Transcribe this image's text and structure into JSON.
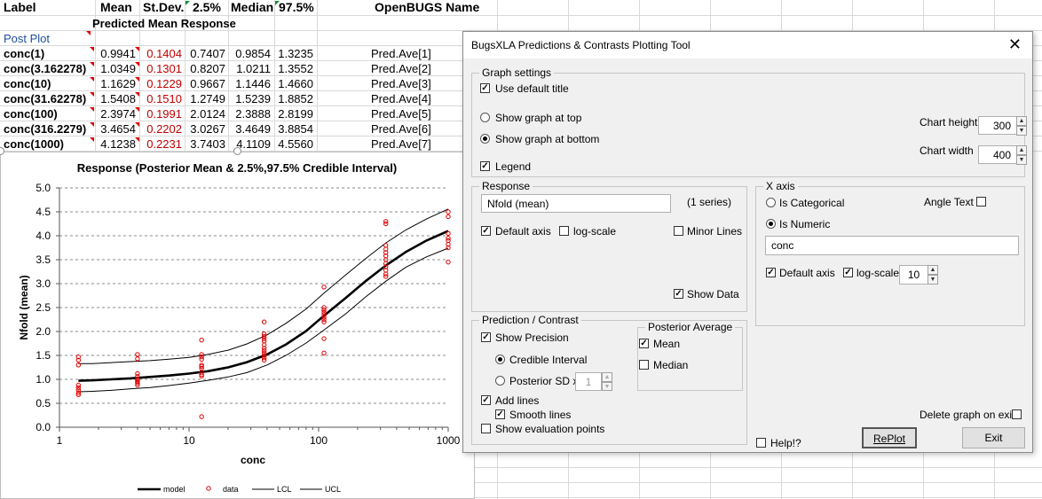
{
  "sheet": {
    "headers": [
      "Label",
      "Mean",
      "St.Dev.",
      "2.5%",
      "Median",
      "97.5%",
      "OpenBUGS Name"
    ],
    "subheader": "Predicted Mean Response",
    "post_plot": "Post Plot",
    "rows": [
      {
        "label": "conc(1)",
        "mean": "0.9941",
        "sd": "0.1404",
        "p25": "0.7407",
        "median": "0.9854",
        "p975": "1.3235",
        "name": "Pred.Ave[1]"
      },
      {
        "label": "conc(3.162278)",
        "mean": "1.0349",
        "sd": "0.1301",
        "p25": "0.8207",
        "median": "1.0211",
        "p975": "1.3552",
        "name": "Pred.Ave[2]"
      },
      {
        "label": "conc(10)",
        "mean": "1.1629",
        "sd": "0.1229",
        "p25": "0.9667",
        "median": "1.1446",
        "p975": "1.4660",
        "name": "Pred.Ave[3]"
      },
      {
        "label": "conc(31.62278)",
        "mean": "1.5408",
        "sd": "0.1510",
        "p25": "1.2749",
        "median": "1.5239",
        "p975": "1.8852",
        "name": "Pred.Ave[4]"
      },
      {
        "label": "conc(100)",
        "mean": "2.3974",
        "sd": "0.1991",
        "p25": "2.0124",
        "median": "2.3888",
        "p975": "2.8199",
        "name": "Pred.Ave[5]"
      },
      {
        "label": "conc(316.2279)",
        "mean": "3.4654",
        "sd": "0.2202",
        "p25": "3.0267",
        "median": "3.4649",
        "p975": "3.8854",
        "name": "Pred.Ave[6]"
      },
      {
        "label": "conc(1000)",
        "mean": "4.1238",
        "sd": "0.2231",
        "p25": "3.7403",
        "median": "4.1109",
        "p975": "4.5560",
        "name": "Pred.Ave[7]"
      }
    ]
  },
  "chart": {
    "title": "Response (Posterior Mean & 2.5%,97.5% Credible Interval)",
    "xlabel": "conc",
    "ylabel": "Nfold (mean)",
    "legend": {
      "model": "model",
      "data": "data",
      "lcl": "LCL",
      "ucl": "UCL"
    }
  },
  "chart_data": {
    "type": "line",
    "title": "Response (Posterior Mean & 2.5%,97.5% Credible Interval)",
    "xlabel": "conc",
    "ylabel": "Nfold (mean)",
    "xscale": "log",
    "xlim": [
      1,
      1000
    ],
    "ylim": [
      0.0,
      5.0
    ],
    "xticks": [
      "1",
      "10",
      "100",
      "1000"
    ],
    "yticks": [
      "0.0",
      "0.5",
      "1.0",
      "1.5",
      "2.0",
      "2.5",
      "3.0",
      "3.5",
      "4.0",
      "4.5",
      "5.0"
    ],
    "grid": "horizontal-dashed",
    "legend_position": "bottom",
    "series": [
      {
        "name": "model",
        "style": "thick-line",
        "x": [
          1.4,
          1.8,
          2.5,
          3.5,
          5,
          7,
          10,
          14,
          20,
          28,
          40,
          56,
          80,
          110,
          160,
          230,
          330,
          470,
          680,
          1000
        ],
        "y": [
          0.97,
          0.98,
          1.0,
          1.02,
          1.05,
          1.08,
          1.12,
          1.17,
          1.25,
          1.36,
          1.52,
          1.73,
          2.01,
          2.33,
          2.69,
          3.05,
          3.38,
          3.66,
          3.9,
          4.1
        ]
      },
      {
        "name": "LCL",
        "style": "thin-line",
        "x": [
          1.4,
          1.8,
          2.5,
          3.5,
          5,
          7,
          10,
          14,
          20,
          28,
          40,
          56,
          80,
          110,
          160,
          230,
          330,
          470,
          680,
          1000
        ],
        "y": [
          0.74,
          0.75,
          0.77,
          0.8,
          0.83,
          0.87,
          0.92,
          0.98,
          1.05,
          1.14,
          1.3,
          1.5,
          1.76,
          2.03,
          2.36,
          2.72,
          3.05,
          3.34,
          3.56,
          3.74
        ]
      },
      {
        "name": "UCL",
        "style": "thin-line",
        "x": [
          1.4,
          1.8,
          2.5,
          3.5,
          5,
          7,
          10,
          14,
          20,
          28,
          40,
          56,
          80,
          110,
          160,
          230,
          330,
          470,
          680,
          1000
        ],
        "y": [
          1.33,
          1.33,
          1.35,
          1.37,
          1.39,
          1.42,
          1.46,
          1.52,
          1.61,
          1.74,
          1.93,
          2.17,
          2.47,
          2.8,
          3.17,
          3.52,
          3.85,
          4.12,
          4.35,
          4.56
        ]
      },
      {
        "name": "data",
        "style": "points",
        "x": [
          1.4,
          1.4,
          1.4,
          1.4,
          1.4,
          1.4,
          1.4,
          1.4,
          4,
          4,
          4,
          4,
          4,
          4,
          4,
          4,
          4,
          12.5,
          12.5,
          12.5,
          12.5,
          12.5,
          12.5,
          12.5,
          12.5,
          12.5,
          12.5,
          12.5,
          38,
          38,
          38,
          38,
          38,
          38,
          38,
          38,
          38,
          38,
          38,
          38,
          110,
          110,
          110,
          110,
          110,
          110,
          110,
          110,
          110,
          110,
          330,
          330,
          330,
          330,
          330,
          330,
          330,
          330,
          330,
          330,
          330,
          330,
          1000,
          1000,
          1000,
          1000,
          1000,
          1000,
          1000,
          1000
        ],
        "y": [
          1.47,
          1.4,
          1.3,
          0.88,
          0.83,
          0.78,
          0.72,
          0.68,
          1.52,
          1.43,
          1.12,
          1.06,
          1.01,
          0.98,
          0.95,
          0.92,
          0.88,
          1.82,
          1.52,
          1.47,
          1.42,
          1.3,
          1.27,
          1.23,
          1.15,
          1.1,
          1.07,
          0.22,
          2.2,
          1.95,
          1.9,
          1.85,
          1.8,
          1.72,
          1.65,
          1.6,
          1.55,
          1.5,
          1.45,
          1.4,
          2.93,
          2.5,
          2.45,
          2.4,
          2.35,
          2.3,
          2.25,
          2.2,
          1.85,
          1.55,
          4.3,
          4.25,
          3.8,
          3.72,
          3.65,
          3.58,
          3.5,
          3.42,
          3.35,
          3.28,
          3.2,
          3.15,
          4.5,
          4.4,
          4.05,
          3.95,
          3.9,
          3.82,
          3.75,
          3.45
        ]
      }
    ]
  },
  "dialog": {
    "title": "BugsXLA Predictions & Contrasts Plotting Tool",
    "graph_settings": "Graph settings",
    "use_default_title": "Use default title",
    "show_top": "Show graph at top",
    "show_bottom": "Show graph at bottom",
    "legend": "Legend",
    "chart_height_label": "Chart height",
    "chart_height": "300",
    "chart_width_label": "Chart width",
    "chart_width": "400",
    "response": "Response",
    "response_value": "Nfold (mean)",
    "series_count": "(1 series)",
    "default_axis": "Default axis",
    "log_scale": "log-scale",
    "minor_lines": "Minor Lines",
    "show_data": "Show Data",
    "x_axis": "X axis",
    "is_categorical": "Is Categorical",
    "angle_text": "Angle Text",
    "is_numeric": "Is Numeric",
    "x_value": "conc",
    "x_default_axis": "Default axis",
    "x_log_scale": "log-scale",
    "log_base": "10",
    "pred_contrast": "Prediction / Contrast",
    "show_precision": "Show Precision",
    "credible_interval": "Credible Interval",
    "posterior_sd": "Posterior SD x",
    "sd_mult": "1",
    "posterior_average": "Posterior Average",
    "mean": "Mean",
    "median": "Median",
    "add_lines": "Add lines",
    "smooth_lines": "Smooth lines",
    "show_eval": "Show evaluation points",
    "delete_on_exit": "Delete graph on exit",
    "help": "Help!?",
    "replot": "RePlot",
    "exit": "Exit",
    "close_glyph": "✕"
  }
}
